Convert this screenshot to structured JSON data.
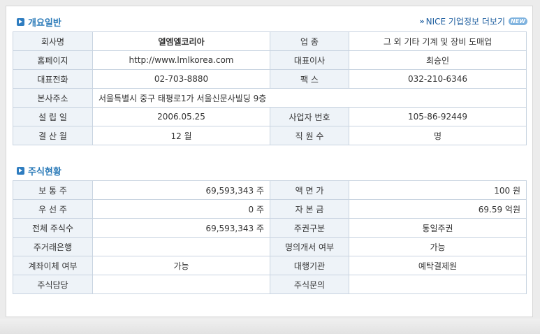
{
  "overview": {
    "title": "개요일반",
    "more_link": "NICE 기업정보 더보기",
    "new_badge": "NEW",
    "rows": [
      {
        "l1": "회사명",
        "v1": "엘엠엘코리아",
        "l2": "업 종",
        "v2": "그 외 기타 기계 및 장비 도매업"
      },
      {
        "l1": "홈페이지",
        "v1": "http://www.lmlkorea.com",
        "l2": "대표이사",
        "v2": "최승인"
      },
      {
        "l1": "대표전화",
        "v1": "02-703-8880",
        "l2": "팩 스",
        "v2": "032-210-6346"
      },
      {
        "l1": "본사주소",
        "v1": "서울특별시 중구 태평로1가 서울신문사빌딩 9층"
      },
      {
        "l1": "설 립 일",
        "v1": "2006.05.25",
        "l2": "사업자 번호",
        "v2": "105-86-92449"
      },
      {
        "l1": "결 산 월",
        "v1": "12 월",
        "l2": "직 원 수",
        "v2": "명"
      }
    ]
  },
  "stock": {
    "title": "주식현황",
    "rows": [
      {
        "l1": "보 통 주",
        "v1": "69,593,343 주",
        "l2": "액 면 가",
        "v2": "100 원"
      },
      {
        "l1": "우 선 주",
        "v1": "0 주",
        "l2": "자 본 금",
        "v2": "69.59 억원"
      },
      {
        "l1": "전체 주식수",
        "v1": "69,593,343 주",
        "l2": "주권구분",
        "v2": "통일주권"
      },
      {
        "l1": "주거래은행",
        "v1": "",
        "l2": "명의개서 여부",
        "v2": "가능"
      },
      {
        "l1": "계좌이체 여부",
        "v1": "가능",
        "l2": "대행기관",
        "v2": "예탁결제원"
      },
      {
        "l1": "주식담당",
        "v1": "",
        "l2": "주식문의",
        "v2": ""
      }
    ]
  }
}
